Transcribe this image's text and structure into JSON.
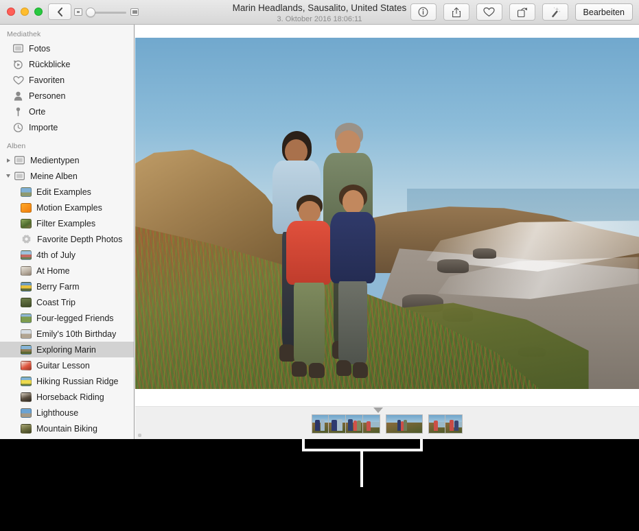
{
  "window": {
    "title": "Marin Headlands, Sausalito, United States",
    "subtitle": "3. Oktober 2016 18:06:11"
  },
  "titlebar": {
    "traffic_lights": [
      {
        "name": "close",
        "color": "#ff5f57"
      },
      {
        "name": "minimize",
        "color": "#ffbd2e"
      },
      {
        "name": "zoom",
        "color": "#28c840"
      }
    ],
    "back_button": {
      "icon": "chevron-left-icon",
      "label": ""
    },
    "zoom_slider": {
      "min_icon": "small-thumbnail-icon",
      "max_icon": "large-thumbnail-icon",
      "value": 18
    },
    "tools": [
      {
        "name": "info-button",
        "icon": "info-circle-icon",
        "label": ""
      },
      {
        "name": "share-button",
        "icon": "share-icon",
        "label": ""
      },
      {
        "name": "favorite-button",
        "icon": "heart-icon",
        "label": ""
      },
      {
        "name": "rotate-button",
        "icon": "rotate-icon",
        "label": ""
      },
      {
        "name": "enhance-button",
        "icon": "magic-wand-icon",
        "label": ""
      }
    ],
    "edit_button_label": "Bearbeiten"
  },
  "sidebar": {
    "sections": [
      {
        "header": "Mediathek",
        "items": [
          {
            "label": "Fotos",
            "icon": "photos-icon"
          },
          {
            "label": "Rückblicke",
            "icon": "memories-icon"
          },
          {
            "label": "Favoriten",
            "icon": "heart-icon"
          },
          {
            "label": "Personen",
            "icon": "person-icon"
          },
          {
            "label": "Orte",
            "icon": "pin-icon"
          },
          {
            "label": "Importe",
            "icon": "clock-icon"
          }
        ]
      },
      {
        "header": "Alben",
        "items": [
          {
            "label": "Medientypen",
            "icon": "folder-icon",
            "disclosure": "collapsed",
            "level": 0
          },
          {
            "label": "Meine Alben",
            "icon": "folder-icon",
            "disclosure": "expanded",
            "level": 0
          },
          {
            "label": "Edit Examples",
            "icon": "album-thumb",
            "level": 1,
            "thumb": "#4c7ba4"
          },
          {
            "label": "Motion Examples",
            "icon": "album-thumb",
            "level": 1,
            "thumb": "#f59a23"
          },
          {
            "label": "Filter Examples",
            "icon": "album-thumb",
            "level": 1,
            "thumb": "#6c8d4a"
          },
          {
            "label": "Favorite Depth Photos",
            "icon": "gear-icon",
            "level": 1,
            "thumb": ""
          },
          {
            "label": "4th of July",
            "icon": "album-thumb",
            "level": 1,
            "thumb": "#7a9ec4"
          },
          {
            "label": "At Home",
            "icon": "album-thumb",
            "level": 1,
            "thumb": "#c9c2b6"
          },
          {
            "label": "Berry Farm",
            "icon": "album-thumb",
            "level": 1,
            "thumb": "#d8b13c"
          },
          {
            "label": "Coast Trip",
            "icon": "album-thumb",
            "level": 1,
            "thumb": "#5c6b3d"
          },
          {
            "label": "Four-legged Friends",
            "icon": "album-thumb",
            "level": 1,
            "thumb": "#73924f"
          },
          {
            "label": "Emily's 10th Birthday",
            "icon": "album-thumb",
            "level": 1,
            "thumb": "#b6c3cf"
          },
          {
            "label": "Exploring Marin",
            "icon": "album-thumb",
            "level": 1,
            "thumb": "#8aa7bf",
            "selected": true
          },
          {
            "label": "Guitar Lesson",
            "icon": "album-thumb",
            "level": 1,
            "thumb": "#d8604a"
          },
          {
            "label": "Hiking Russian Ridge",
            "icon": "album-thumb",
            "level": 1,
            "thumb": "#e8d24f"
          },
          {
            "label": "Horseback Riding",
            "icon": "album-thumb",
            "level": 1,
            "thumb": "#4a4239"
          },
          {
            "label": "Lighthouse",
            "icon": "album-thumb",
            "level": 1,
            "thumb": "#5c8fbe"
          },
          {
            "label": "Mountain Biking",
            "icon": "album-thumb",
            "level": 1,
            "thumb": "#7a7a52"
          }
        ]
      }
    ]
  },
  "main": {
    "photo_alt": "Family of four standing on a coastal cliff above a beach at Marin Headlands",
    "filmstrip": {
      "caret": "current-photo-marker",
      "groups": [
        {
          "thumbs": 4
        },
        {
          "thumbs": 1,
          "wide": true
        },
        {
          "thumbs": 2
        }
      ]
    }
  },
  "callout": {
    "bracket": "filmstrip-callout-bracket",
    "stem": "filmstrip-callout-stem"
  },
  "colors": {
    "selection": "#d2d2d2",
    "sidebar_bg": "#f6f6f6",
    "filmstrip_bg": "#efefef",
    "backdrop": "#000000"
  }
}
